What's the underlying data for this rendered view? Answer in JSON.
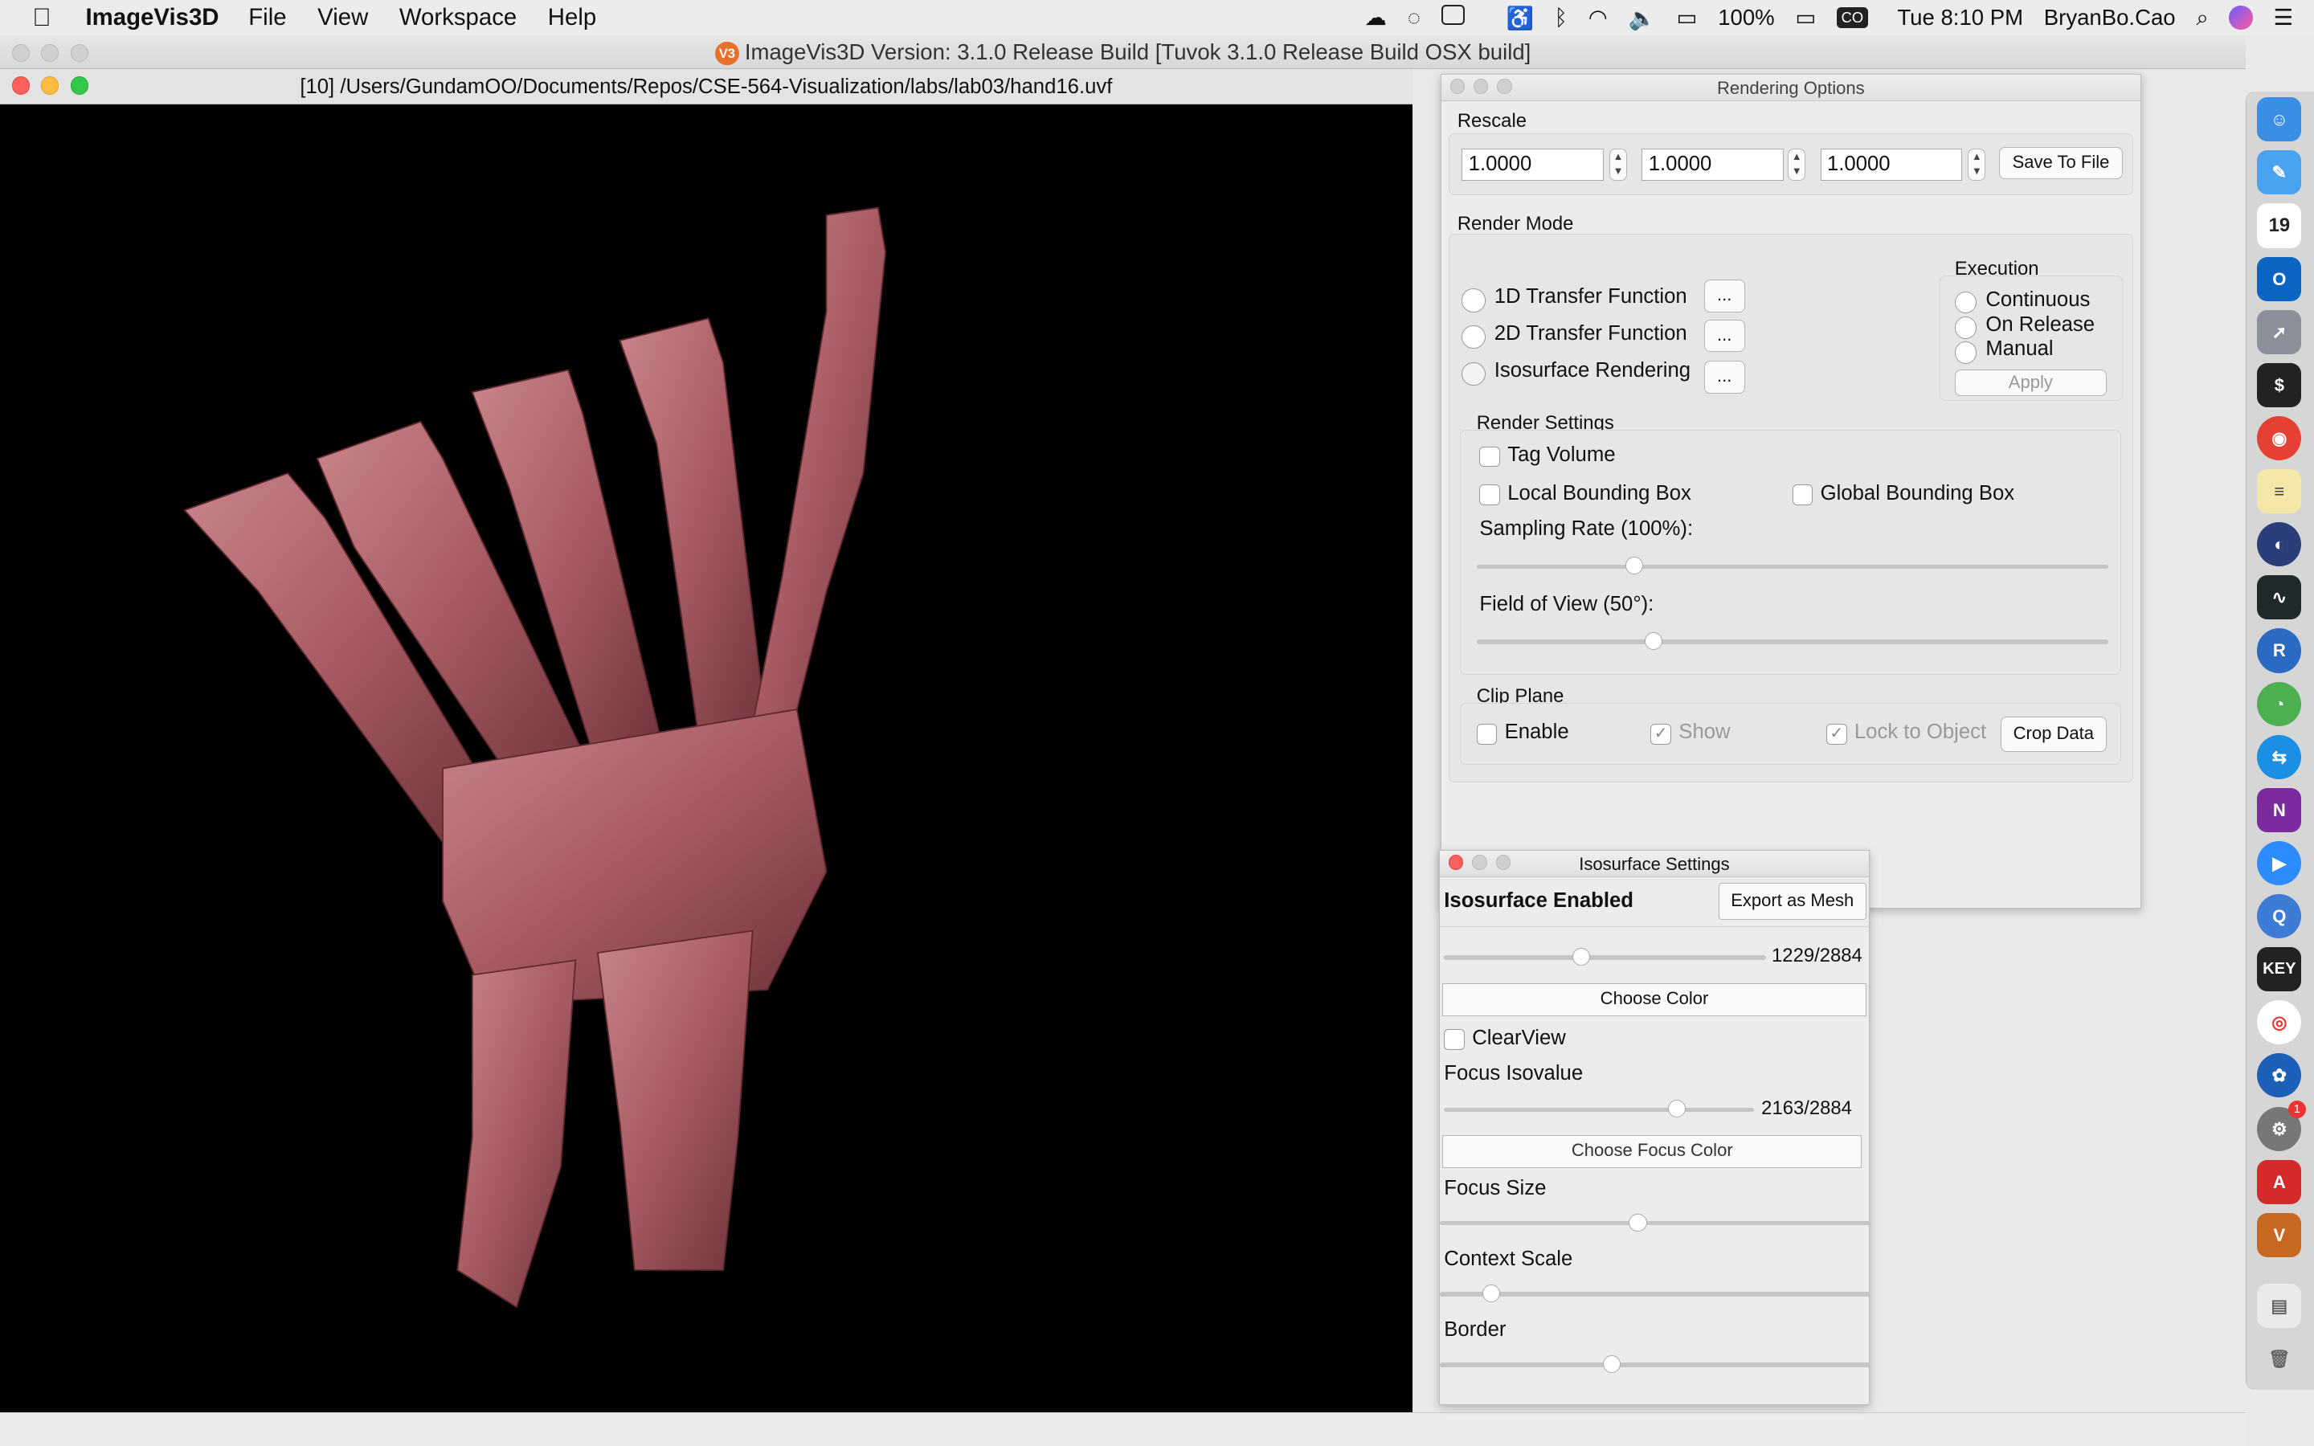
{
  "menubar": {
    "apple_icon": "apple-logo-icon",
    "app_name": "ImageVis3D",
    "items": [
      "File",
      "View",
      "Workspace",
      "Help"
    ],
    "battery": "100%",
    "clock": "Tue 8:10 PM",
    "user": "BryanBo.Cao",
    "input_badge": "CO"
  },
  "app_title": "ImageVis3D Version: 3.1.0 Release Build [Tuvok 3.1.0 Release Build OSX build]",
  "app_logo": "V3",
  "render_window": {
    "title": "[10] /Users/GundamOO/Documents/Repos/CSE-564-Visualization/labs/lab03/hand16.uvf",
    "mesh_color": "#a85a62"
  },
  "rendering_options": {
    "title": "Rendering Options",
    "rescale": {
      "label": "Rescale",
      "x": "1.0000",
      "y": "1.0000",
      "z": "1.0000",
      "save_label": "Save To File"
    },
    "render_mode": {
      "label": "Render Mode",
      "options": [
        "1D Transfer Function",
        "2D Transfer Function",
        "Isosurface Rendering"
      ],
      "more_label": "..."
    },
    "execution": {
      "label": "Execution",
      "options": [
        "Continuous",
        "On Release",
        "Manual"
      ],
      "apply_label": "Apply"
    },
    "render_settings": {
      "label": "Render Settings",
      "tag_volume": "Tag Volume",
      "local_bbox": "Local Bounding Box",
      "global_bbox": "Global Bounding Box",
      "sampling_label": "Sampling Rate (100%):",
      "sampling_value": 0.25,
      "fov_label": "Field of View (50°):",
      "fov_value": 0.28
    },
    "clip_plane": {
      "label": "Clip Plane",
      "enable": "Enable",
      "show": "Show",
      "lock": "Lock to Object",
      "crop_label": "Crop Data"
    }
  },
  "isosurface_settings": {
    "title": "Isosurface Settings",
    "enabled_label": "Isosurface Enabled",
    "export_label": "Export as Mesh",
    "iso_value_text": "1229/2884",
    "iso_value": 0.426,
    "choose_color": "Choose Color",
    "clearview_label": "ClearView",
    "focus_isovalue_label": "Focus Isovalue",
    "focus_isovalue_text": "2163/2884",
    "focus_isovalue": 0.75,
    "choose_focus_color": "Choose Focus Color",
    "focus_size_label": "Focus Size",
    "focus_size": 0.46,
    "context_scale_label": "Context Scale",
    "context_scale": 0.12,
    "border_label": "Border",
    "border": 0.4
  },
  "dock": {
    "calendar_day": "19",
    "keynote_label": "KEY",
    "notification_badge": "1"
  }
}
